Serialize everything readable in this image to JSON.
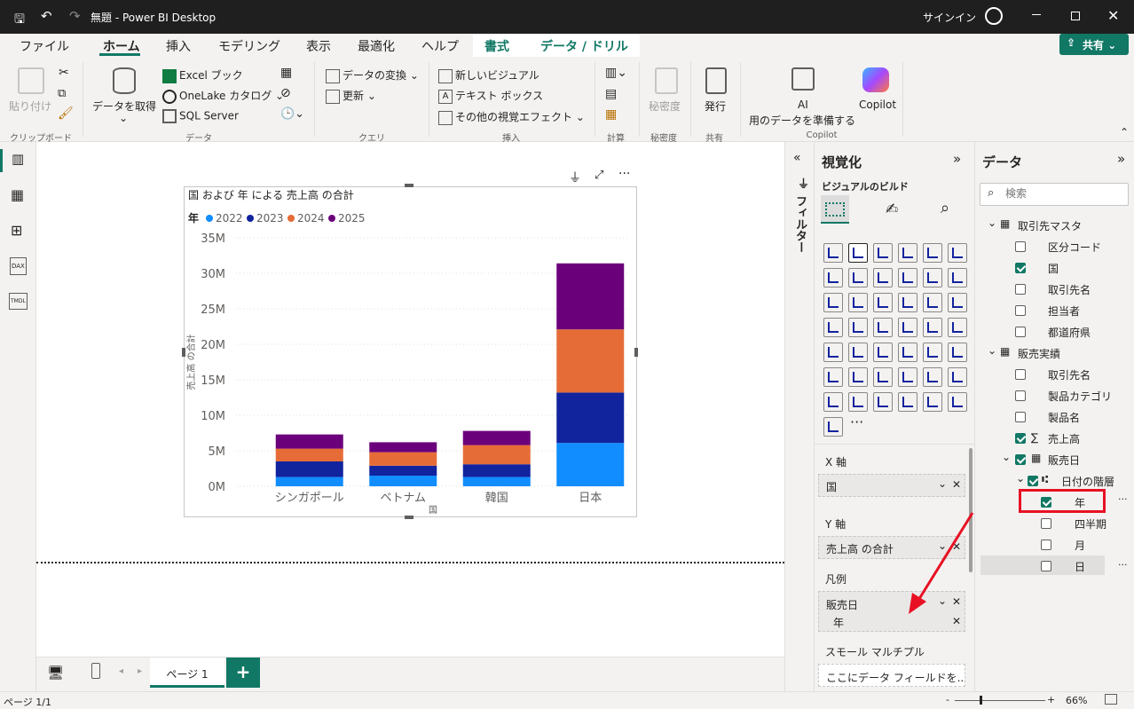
{
  "window": {
    "title": "無題 - Power BI Desktop",
    "signin": "サインイン"
  },
  "menu": [
    "ファイル",
    "ホーム",
    "挿入",
    "モデリング",
    "表示",
    "最適化",
    "ヘルプ",
    "書式",
    "データ / ドリル"
  ],
  "share": "共有",
  "ribbon": {
    "paste": "貼り付け",
    "get_data": "データを取得",
    "excel": "Excel ブック",
    "onelake": "OneLake カタログ",
    "sql": "SQL Server",
    "transform": "データの変換",
    "refresh": "更新",
    "new_visual": "新しいビジュアル",
    "textbox": "テキスト ボックス",
    "more_visuals": "その他の視覚エフェクト",
    "sensitivity": "秘密度",
    "publish": "発行",
    "ai_line1": "AI",
    "ai_line2": "用のデータを準備する",
    "copilot": "Copilot",
    "groups": [
      "クリップボード",
      "データ",
      "クエリ",
      "挿入",
      "計算",
      "秘密度",
      "共有",
      "Copilot"
    ]
  },
  "chart_data": {
    "type": "bar",
    "stacked": true,
    "title": "国 および 年 による 売上高 の合計",
    "legend_title": "年",
    "xlabel": "国",
    "ylabel": "売上高 の合計",
    "categories": [
      "シンガポール",
      "ベトナム",
      "韓国",
      "日本"
    ],
    "series": [
      {
        "name": "2022",
        "color": "#118dff",
        "values": [
          1.3,
          1.5,
          1.3,
          6.1
        ]
      },
      {
        "name": "2023",
        "color": "#12239e",
        "values": [
          2.2,
          1.4,
          1.8,
          7.1
        ]
      },
      {
        "name": "2024",
        "color": "#e66c37",
        "values": [
          1.8,
          1.9,
          2.7,
          8.9
        ]
      },
      {
        "name": "2025",
        "color": "#6b007b",
        "values": [
          2.0,
          1.4,
          2.0,
          9.3
        ]
      }
    ],
    "ylim": [
      0,
      35
    ],
    "yticks": [
      "0M",
      "5M",
      "10M",
      "15M",
      "20M",
      "25M",
      "30M",
      "35M"
    ]
  },
  "pages": {
    "current": "ページ 1",
    "status": "ページ 1/1",
    "zoom": "66%"
  },
  "filter_pane": "フィルター",
  "viz": {
    "title": "視覚化",
    "build": "ビジュアルのビルド",
    "x_label": "X 軸",
    "x_value": "国",
    "y_label": "Y 軸",
    "y_value": "売上高 の合計",
    "legend_label": "凡例",
    "legend_value": "販売日",
    "legend_sub": "年",
    "small_multiples": "スモール マルチプル",
    "placeholder": "ここにデータ フィールドを..."
  },
  "data": {
    "title": "データ",
    "search_placeholder": "検索",
    "tables": [
      {
        "name": "取引先マスタ",
        "fields": [
          {
            "name": "区分コード",
            "checked": false
          },
          {
            "name": "国",
            "checked": true
          },
          {
            "name": "取引先名",
            "checked": false
          },
          {
            "name": "担当者",
            "checked": false
          },
          {
            "name": "都道府県",
            "checked": false
          }
        ]
      },
      {
        "name": "販売実績",
        "fields": [
          {
            "name": "取引先名",
            "checked": false
          },
          {
            "name": "製品カテゴリ",
            "checked": false
          },
          {
            "name": "製品名",
            "checked": false
          },
          {
            "name": "売上高",
            "checked": true
          }
        ]
      }
    ],
    "date_field": "販売日",
    "hierarchy": "日付の階層",
    "levels": [
      {
        "name": "年",
        "checked": true
      },
      {
        "name": "四半期",
        "checked": false
      },
      {
        "name": "月",
        "checked": false
      },
      {
        "name": "日",
        "checked": false
      }
    ]
  }
}
